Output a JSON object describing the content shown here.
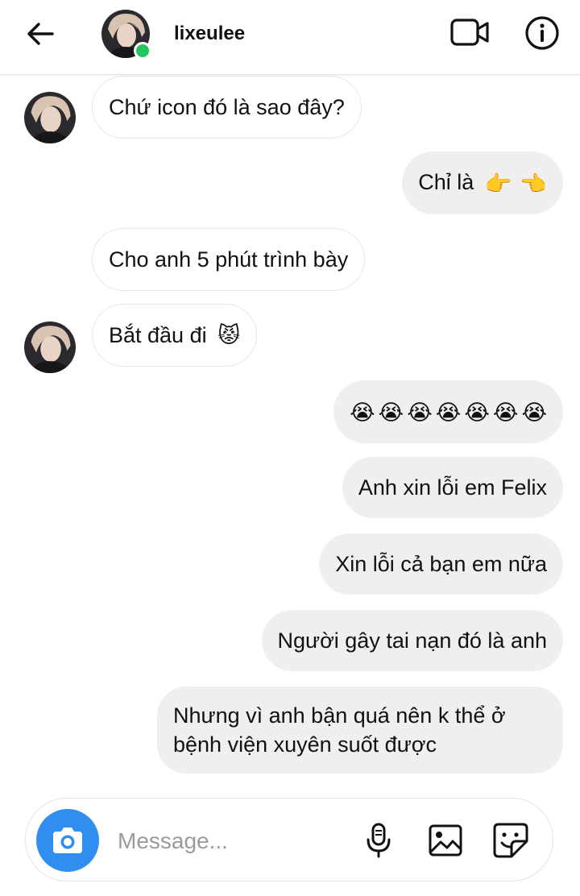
{
  "header": {
    "username": "lixeulee",
    "online": true,
    "icons": [
      "back-arrow-icon",
      "video-call-icon",
      "info-icon"
    ]
  },
  "messages": [
    {
      "side": "in",
      "text": "Chứ icon đó là sao đây?",
      "show_avatar": true
    },
    {
      "side": "out",
      "text": "Chỉ là",
      "emojis": [
        "👉",
        "👈"
      ]
    },
    {
      "side": "in",
      "text": "Cho anh 5 phút trình bày",
      "show_avatar": false
    },
    {
      "side": "in",
      "text": "Bắt đầu đi",
      "emojis": [
        "😾"
      ],
      "show_avatar": true
    },
    {
      "side": "out",
      "emojis": [
        "😭",
        "😭",
        "😭",
        "😭",
        "😭",
        "😭",
        "😭"
      ]
    },
    {
      "side": "out",
      "text": "Anh xin lỗi em Felix"
    },
    {
      "side": "out",
      "text": "Xin lỗi cả bạn em nữa"
    },
    {
      "side": "out",
      "text": "Người gây tai nạn đó là anh"
    },
    {
      "side": "out",
      "text": "Nhưng vì anh bận quá nên k thể ở bệnh viện xuyên suốt được"
    }
  ],
  "composer": {
    "placeholder": "Message...",
    "icons": [
      "camera-icon",
      "microphone-icon",
      "gallery-icon",
      "sticker-icon"
    ]
  },
  "colors": {
    "camera_button": "#2f8ef0",
    "online_dot": "#22c55e",
    "outgoing_bubble": "#efefef",
    "incoming_bubble_border": "#e6e6e6"
  }
}
